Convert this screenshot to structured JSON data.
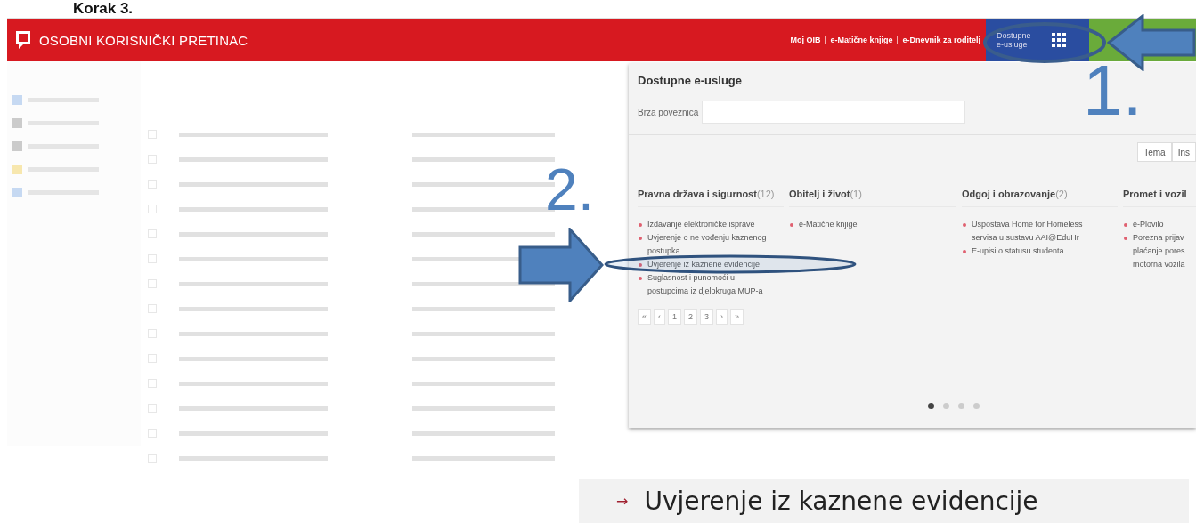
{
  "heading": "Korak 3.",
  "header": {
    "title": "OSOBNI KORISNIČKI PRETINAC",
    "links": [
      "Moj OIB",
      "e-Matične knjige",
      "e-Dnevnik za roditelj"
    ],
    "services_button": "Dostupne e-usluge"
  },
  "panel": {
    "title": "Dostupne e-usluge",
    "quick_link_label": "Brza poveznica",
    "view_tabs": [
      "Tema",
      "Ins"
    ],
    "categories": [
      {
        "title": "Pravna država i sigurnost",
        "count": "(12)",
        "items": [
          {
            "lines": [
              "Izdavanje elektroničke isprave"
            ]
          },
          {
            "lines": [
              "Uvjerenje o ne vođenju kaznenog",
              "postupka"
            ]
          },
          {
            "lines": [
              "Uvjerenje iz kaznene evidencije"
            ]
          },
          {
            "lines": [
              "Suglasnost i punomoći u",
              "postupcima iz djelokruga MUP-a"
            ]
          }
        ],
        "pager": [
          "«",
          "‹",
          "1",
          "2",
          "3",
          "›",
          "»"
        ]
      },
      {
        "title": "Obitelj i život",
        "count": "(1)",
        "items": [
          {
            "lines": [
              "e-Matične knjige"
            ]
          }
        ]
      },
      {
        "title": "Odgoj i obrazovanje",
        "count": "(2)",
        "items": [
          {
            "lines": [
              "Uspostava Home for Homeless",
              "servisa u sustavu AAI@EduHr"
            ]
          },
          {
            "lines": [
              "E-upisi o statusu studenta"
            ]
          }
        ]
      },
      {
        "title": "Promet i vozil",
        "items": [
          {
            "lines": [
              "e-Plovilo"
            ]
          },
          {
            "lines": [
              "Porezna prijav",
              "plaćanje pores",
              "motorna vozila"
            ]
          }
        ]
      }
    ],
    "carousel_dots": [
      {
        "selected": true
      },
      {
        "selected": false
      },
      {
        "selected": false
      },
      {
        "selected": false
      }
    ]
  },
  "annotations": [
    "1.",
    "2."
  ],
  "zoom_strip": {
    "marker": "→",
    "text": "Uvjerenje iz kaznene evidencije"
  }
}
